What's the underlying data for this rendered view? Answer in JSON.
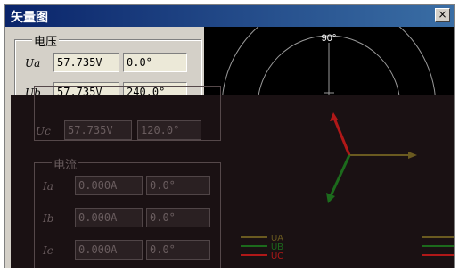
{
  "window": {
    "title": "矢量图",
    "close_label": "×"
  },
  "voltage": {
    "group_label": "电压",
    "rows": [
      {
        "label": "Ua",
        "value": "57.735V",
        "angle": "0.0°"
      },
      {
        "label": "Ub",
        "value": "57.735V",
        "angle": "240.0°"
      },
      {
        "label": "Uc",
        "value": "57.735V",
        "angle": "120.0°"
      }
    ]
  },
  "current": {
    "group_label": "电流",
    "rows": [
      {
        "label": "Ia",
        "value": "0.000A",
        "angle": "0.0°"
      },
      {
        "label": "Ib",
        "value": "0.000A",
        "angle": "0.0°"
      },
      {
        "label": "Ic",
        "value": "0.000A",
        "angle": "0.0°"
      }
    ]
  },
  "chart": {
    "angle_label": "90°"
  },
  "legend": {
    "items": [
      "UA",
      "UB",
      "UC"
    ]
  },
  "colors": {
    "ua": "#e0c020",
    "ub": "#20a020",
    "uc": "#d02020"
  }
}
